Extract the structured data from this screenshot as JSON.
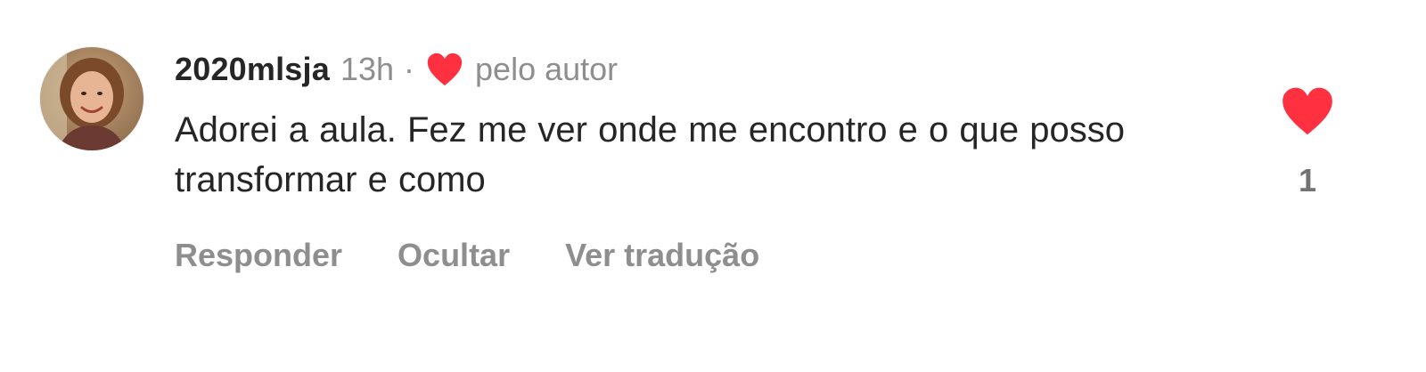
{
  "comment": {
    "username": "2020mlsja",
    "time": "13h",
    "separator": "·",
    "liked_by_author_label": "pelo autor",
    "text": "Adorei a aula. Fez me ver onde me encontro e o que posso transformar e como",
    "like_count": "1",
    "avatar_icon": "user-avatar-photo",
    "liked_color": "#ff3040"
  },
  "actions": {
    "reply_label": "Responder",
    "hide_label": "Ocultar",
    "translate_label": "Ver tradução"
  }
}
